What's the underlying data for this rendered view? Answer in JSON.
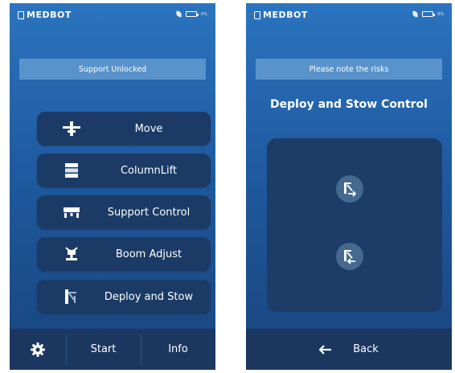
{
  "left_screen": {
    "logo": "MEDBOT",
    "battery_text": "0%",
    "banner": "Support Unlocked",
    "menu": [
      {
        "label": "Move",
        "icon": "move-icon"
      },
      {
        "label": "ColumnLift",
        "icon": "column-lift-icon"
      },
      {
        "label": "Support Control",
        "icon": "support-control-icon"
      },
      {
        "label": "Boom Adjust",
        "icon": "boom-adjust-icon"
      },
      {
        "label": "Deploy and Stow",
        "icon": "deploy-stow-icon"
      }
    ],
    "bottom": {
      "settings_icon": "gear-icon",
      "start": "Start",
      "info": "Info"
    }
  },
  "right_screen": {
    "logo": "MEDBOT",
    "battery_text": "0%",
    "banner": "Please note the risks",
    "heading": "Deploy and Stow Control",
    "buttons": [
      {
        "icon": "deploy-icon"
      },
      {
        "icon": "stow-icon"
      }
    ],
    "bottom": {
      "back_icon": "arrow-left-icon",
      "back": "Back"
    }
  },
  "colors": {
    "screen_top": "#2b74bf",
    "screen_bottom": "#19447c",
    "banner": "#5a93cc",
    "button": "#1b3b66",
    "bottom_bar": "#1b3760",
    "circle_button": "#45698f"
  }
}
